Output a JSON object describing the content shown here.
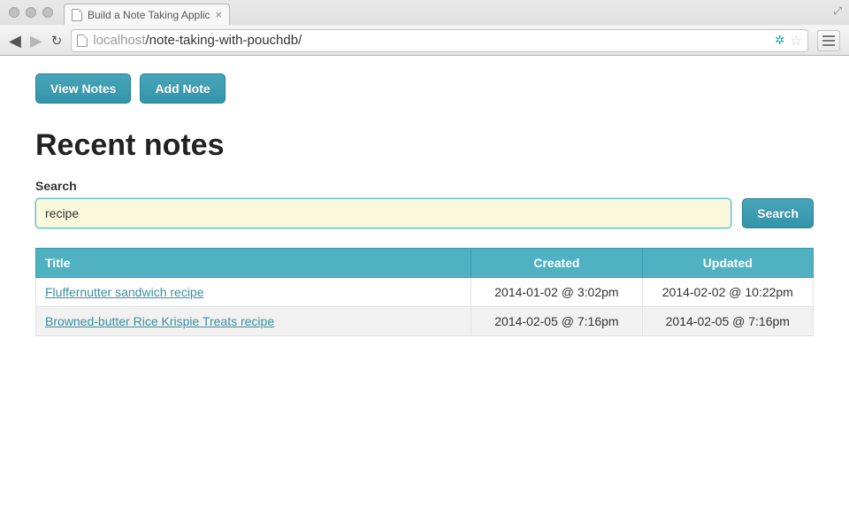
{
  "browser": {
    "tab_title": "Build a Note Taking Applic",
    "url_host": "localhost",
    "url_path": "/note-taking-with-pouchdb/"
  },
  "nav": {
    "view_notes": "View Notes",
    "add_note": "Add Note"
  },
  "heading": "Recent notes",
  "search": {
    "label": "Search",
    "value": "recipe",
    "button": "Search"
  },
  "table": {
    "headers": {
      "title": "Title",
      "created": "Created",
      "updated": "Updated"
    },
    "rows": [
      {
        "title": "Fluffernutter sandwich recipe",
        "created": "2014-01-02 @ 3:02pm",
        "updated": "2014-02-02 @ 10:22pm"
      },
      {
        "title": "Browned-butter Rice Krispie Treats recipe",
        "created": "2014-02-05 @ 7:16pm",
        "updated": "2014-02-05 @ 7:16pm"
      }
    ]
  }
}
